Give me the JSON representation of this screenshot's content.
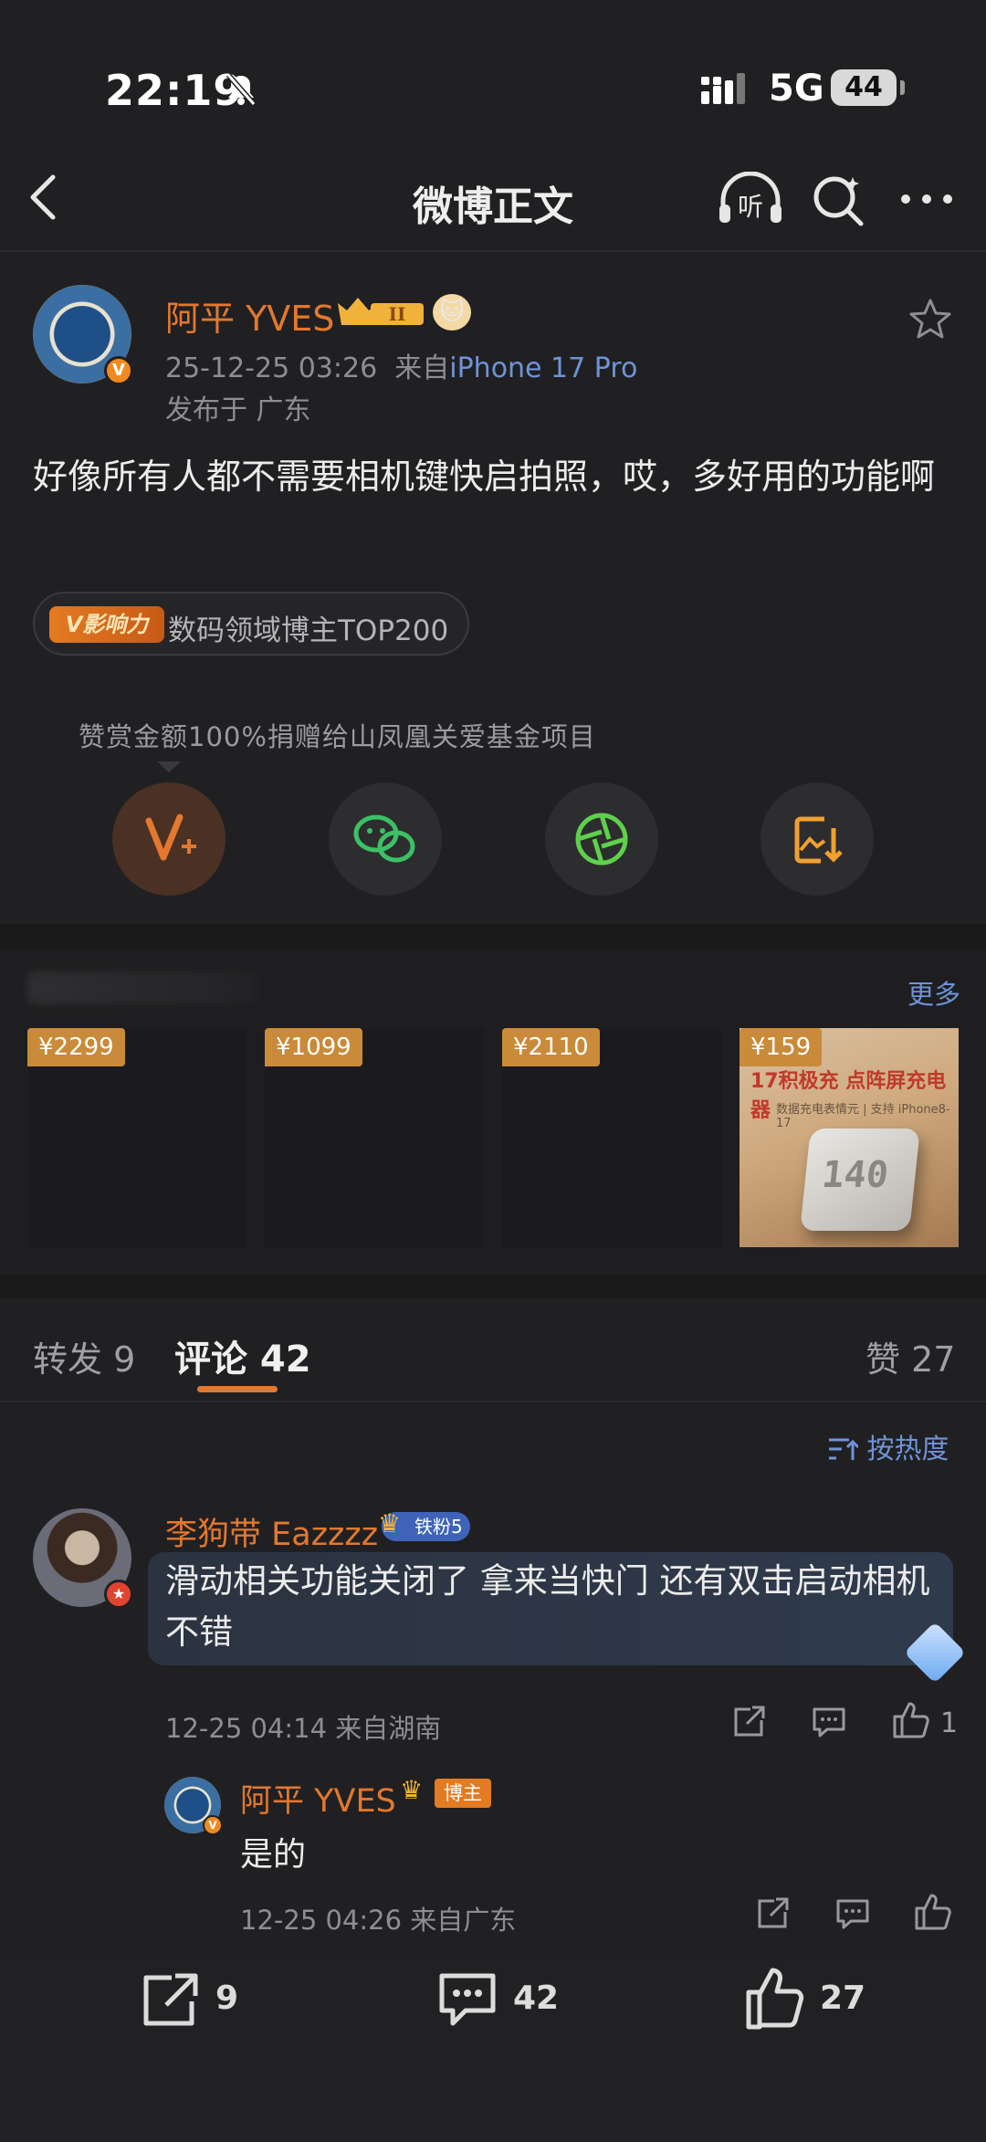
{
  "status_bar": {
    "time": "22:19",
    "network": "5G",
    "battery": "44"
  },
  "nav": {
    "title": "微博正文",
    "listen_label": "听"
  },
  "post": {
    "author": "阿平 YVES",
    "time": "25-12-25 03:26",
    "source_prefix": "来自",
    "source_device": "iPhone 17 Pro",
    "location": "发布于 广东",
    "text": "好像所有人都不需要相机键快启拍照，哎，多好用的功能啊",
    "influence_logo": "V影响力",
    "influence_text": "数码领域博主TOP200",
    "tip_text": "赞赏金额100%捐赠给山凤凰关爱基金项目"
  },
  "shop": {
    "more": "更多",
    "products": [
      {
        "price": "¥2299"
      },
      {
        "price": "¥1099"
      },
      {
        "price": "¥2110"
      },
      {
        "price": "¥159",
        "headline": "17积极充 点阵屏充电器",
        "sub": "数据充电表情元 | 支持 iPhone8-17",
        "charger_text": "140"
      }
    ]
  },
  "tabs": {
    "repost": "转发 9",
    "comments": "评论 42",
    "likes": "赞 27"
  },
  "sort_label": "按热度",
  "comments": [
    {
      "name": "李狗带 Eazzzz",
      "fan_badge": "铁粉5",
      "text": "滑动相关功能关闭了 拿来当快门 还有双击启动相机不错",
      "meta": "12-25 04:14  来自湖南",
      "likes": "1",
      "replies": [
        {
          "name": "阿平 YVES",
          "badge": "博主",
          "text": "是的",
          "meta": "12-25 04:26  来自广东"
        }
      ]
    }
  ],
  "bottom_bar": {
    "shares": "9",
    "comments": "42",
    "likes": "27"
  },
  "colors": {
    "accent": "#e3782e",
    "link": "#6f93d8",
    "background": "#202022"
  }
}
